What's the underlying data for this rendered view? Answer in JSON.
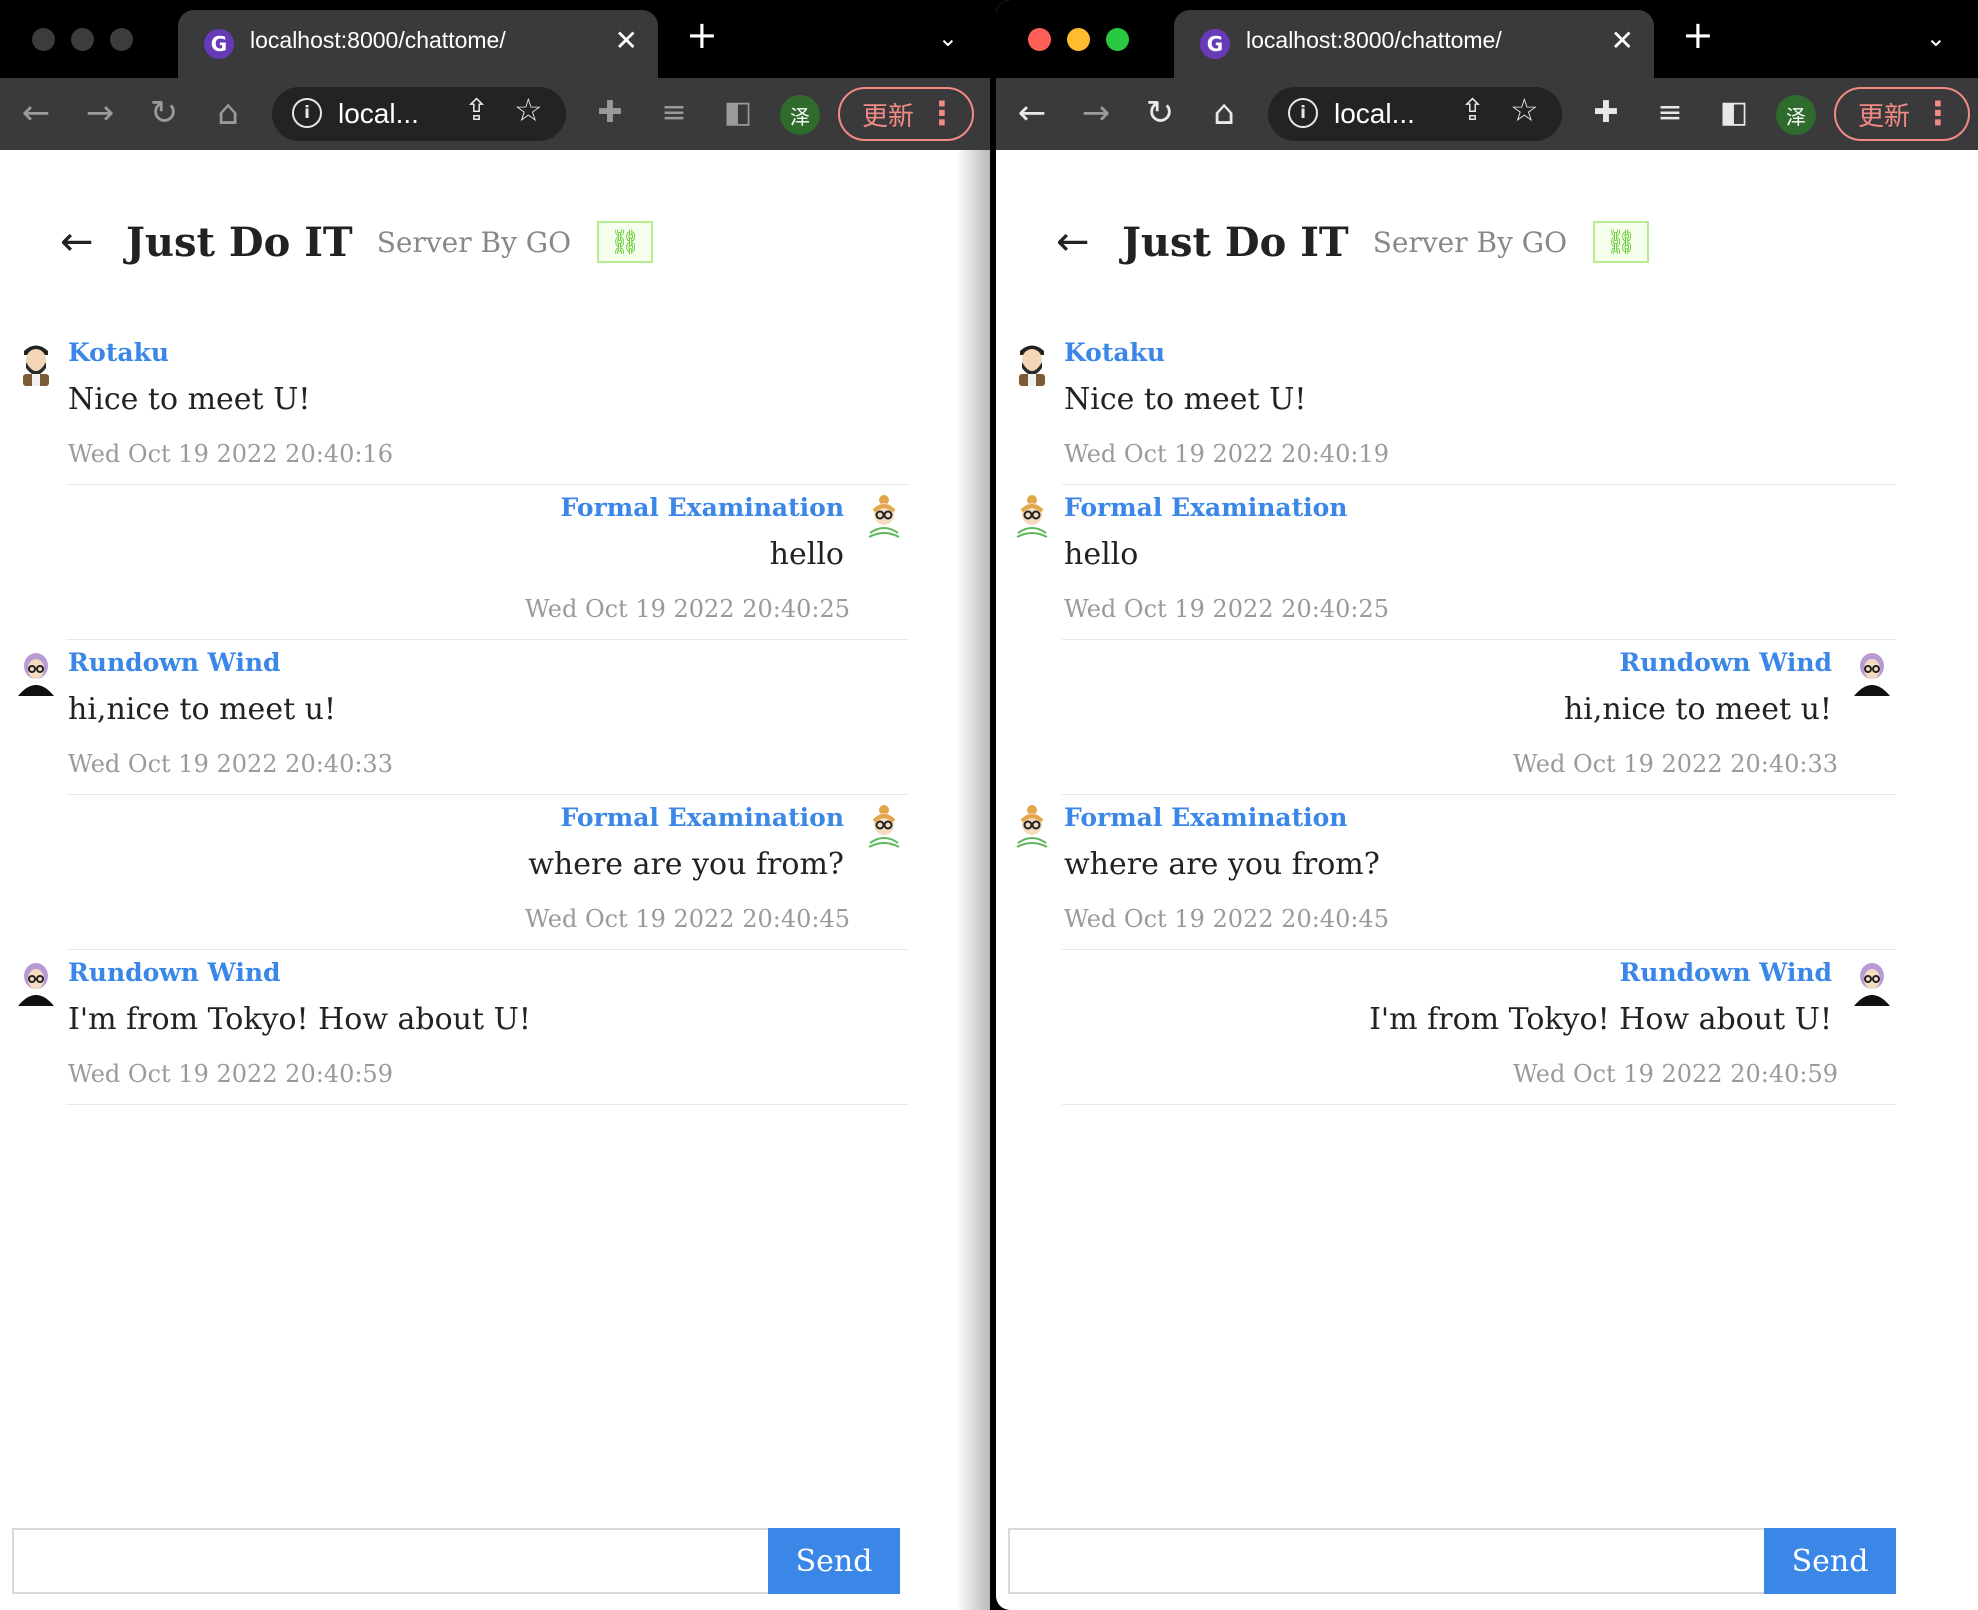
{
  "browser": {
    "tab_title": "localhost:8000/chattome/",
    "tab_favicon": "G",
    "close_glyph": "✕",
    "newtab_glyph": "+",
    "tabmenu_glyph": "⌄",
    "url_short": "local...",
    "profile_initial": "泽",
    "update_label": "更新",
    "kebab_glyph": "⋮",
    "icons": [
      "back-arrow-icon",
      "forward-arrow-icon",
      "reload-icon",
      "home-icon",
      "site-info-icon",
      "share-icon",
      "bookmark-star-icon",
      "extensions-icon",
      "reading-list-icon",
      "side-panel-icon",
      "profile-icon",
      "kebab-menu-icon"
    ]
  },
  "chat": {
    "back_glyph": "←",
    "title": "Just Do IT",
    "subtitle": "Server By GO",
    "link_glyph": "🔗",
    "send_label": "Send",
    "input_value": "",
    "name_color": "#3b87e8",
    "send_color": "#3b87e8"
  },
  "users": {
    "kotaku": "Kotaku",
    "formal": "Formal Examination",
    "rundown": "Rundown Wind"
  },
  "window1": {
    "mode": "inactive",
    "messages": [
      {
        "name": "Kotaku",
        "text": "Nice to meet U!",
        "time": "Wed Oct 19 2022 20:40:16",
        "side": "left",
        "avatar": "bearded-man-avatar-icon"
      },
      {
        "name": "Formal Examination",
        "text": "hello",
        "time": "Wed Oct 19 2022 20:40:25",
        "side": "right",
        "avatar": "glasses-woman-avatar-icon"
      },
      {
        "name": "Rundown Wind",
        "text": "hi,nice to meet u!",
        "time": "Wed Oct 19 2022 20:40:33",
        "side": "left",
        "avatar": "purple-hair-avatar-icon"
      },
      {
        "name": "Formal Examination",
        "text": "where are you from?",
        "time": "Wed Oct 19 2022 20:40:45",
        "side": "right",
        "avatar": "glasses-woman-avatar-icon"
      },
      {
        "name": "Rundown Wind",
        "text": "I'm from Tokyo! How about U!",
        "time": "Wed Oct 19 2022 20:40:59",
        "side": "left",
        "avatar": "purple-hair-avatar-icon"
      }
    ]
  },
  "window2": {
    "mode": "active",
    "messages": [
      {
        "name": "Kotaku",
        "text": "Nice to meet U!",
        "time": "Wed Oct 19 2022 20:40:19",
        "side": "left",
        "avatar": "bearded-man-avatar-icon"
      },
      {
        "name": "Formal Examination",
        "text": "hello",
        "time": "Wed Oct 19 2022 20:40:25",
        "side": "left",
        "avatar": "glasses-woman-avatar-icon"
      },
      {
        "name": "Rundown Wind",
        "text": "hi,nice to meet u!",
        "time": "Wed Oct 19 2022 20:40:33",
        "side": "right",
        "avatar": "purple-hair-avatar-icon"
      },
      {
        "name": "Formal Examination",
        "text": "where are you from?",
        "time": "Wed Oct 19 2022 20:40:45",
        "side": "left",
        "avatar": "glasses-woman-avatar-icon"
      },
      {
        "name": "Rundown Wind",
        "text": "I'm from Tokyo! How about U!",
        "time": "Wed Oct 19 2022 20:40:59",
        "side": "right",
        "avatar": "purple-hair-avatar-icon"
      }
    ]
  },
  "colors": {
    "traffic_red": "#fe5f57",
    "traffic_yellow": "#febc2e",
    "traffic_green": "#28c840",
    "traffic_inactive": "#3c3c3c",
    "toolbar": "#3a3a3c",
    "update_border": "#f28b82",
    "link_border": "#b7eb8f"
  }
}
